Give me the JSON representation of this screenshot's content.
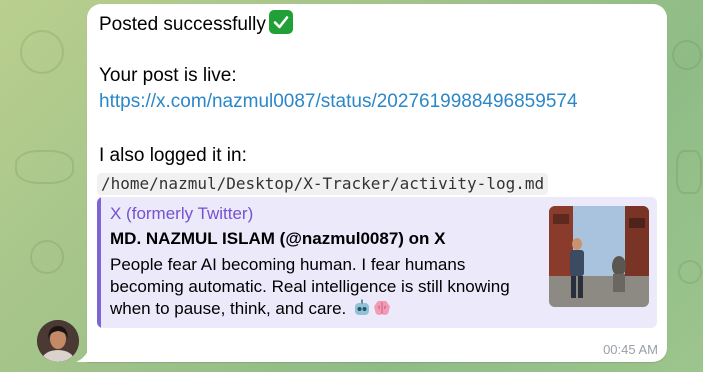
{
  "message": {
    "line1": "Posted successfully",
    "line2": "Your post is live:",
    "link": "https://x.com/nazmul0087/status/2027619988496859574",
    "line3": "I also logged it in:",
    "path": "/home/nazmul/Desktop/X-Tracker/activity-log.md",
    "time": "00:45 AM"
  },
  "preview": {
    "site": "X (formerly Twitter)",
    "title": "MD. NAZMUL ISLAM (@nazmul0087) on X",
    "description": "People fear AI becoming human. I fear humans becoming automatic. Real intelligence is still knowing when to pause, think, and care.",
    "emojis": [
      "robot-face-icon",
      "brain-icon"
    ]
  },
  "colors": {
    "link": "#2b87c8",
    "preview_accent": "#7f64d6",
    "check_green": "#21a038"
  }
}
